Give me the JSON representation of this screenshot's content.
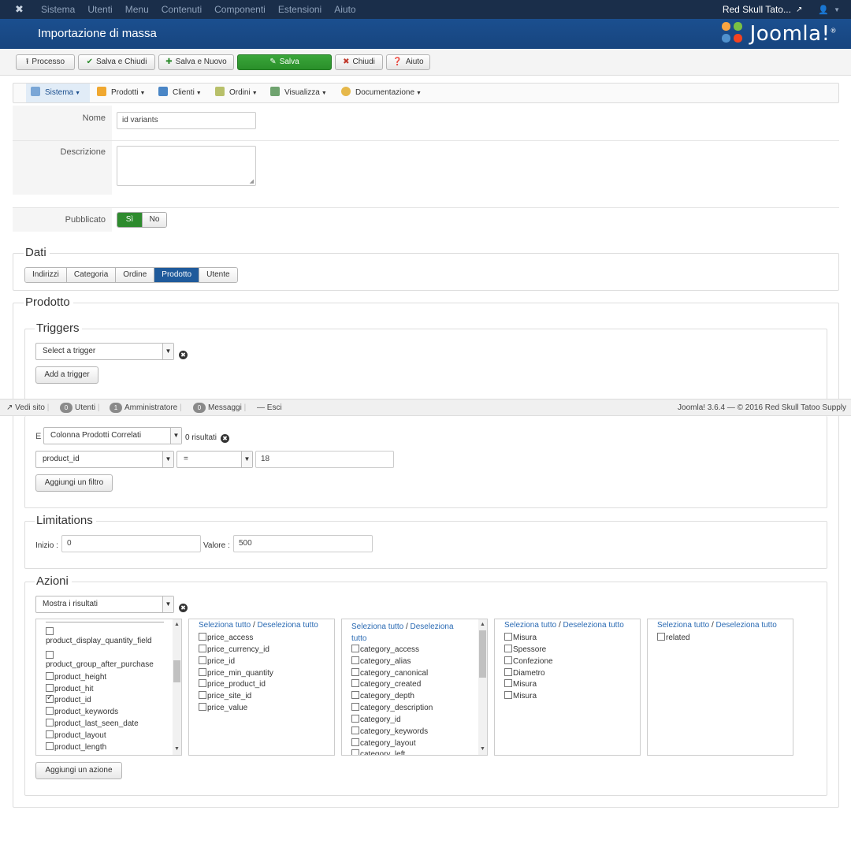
{
  "topbar": {
    "menu": [
      "Sistema",
      "Utenti",
      "Menu",
      "Contenuti",
      "Componenti",
      "Estensioni",
      "Aiuto"
    ],
    "site_name": "Red Skull Tato...",
    "ext_icon": "external-link-icon",
    "user_icon": "user-icon"
  },
  "header": {
    "title": "Importazione di massa",
    "logo_text": "Joomla!",
    "logo_mark": "®"
  },
  "toolbar": {
    "processo": "Processo",
    "salva_chiudi": "Salva e Chiudi",
    "salva_nuovo": "Salva e Nuovo",
    "salva": "Salva",
    "chiudi": "Chiudi",
    "aiuto": "Aiuto"
  },
  "subnav": {
    "items": [
      "Sistema",
      "Prodotti",
      "Clienti",
      "Ordini",
      "Visualizza",
      "Documentazione"
    ]
  },
  "form": {
    "nome_label": "Nome",
    "nome_value": "id variants",
    "descrizione_label": "Descrizione",
    "pubblicato_label": "Pubblicato",
    "si": "Sì",
    "no": "No"
  },
  "dati": {
    "legend": "Dati",
    "tabs": [
      "Indirizzi",
      "Categoria",
      "Ordine",
      "Prodotto",
      "Utente"
    ],
    "active_tab": "Prodotto"
  },
  "prodotto": {
    "legend": "Prodotto"
  },
  "triggers": {
    "legend": "Triggers",
    "select": "Select a trigger",
    "add": "Add a trigger"
  },
  "statusbar": {
    "vedi_sito": "Vedi sito",
    "utenti_count": "0",
    "utenti": "Utenti",
    "admin_count": "1",
    "admin": "Amministratore",
    "msg_count": "0",
    "messaggi": "Messaggi",
    "esci": "Esci",
    "version": "Joomla! 3.6.4 — © 2016 Red Skull Tatoo Supply"
  },
  "filters": {
    "e_label": "E",
    "column_select": "Colonna Prodotti Correlati",
    "results": "0 risultati",
    "field": "product_id",
    "operator": "=",
    "value": "18",
    "add": "Aggiungi un filtro"
  },
  "limitations": {
    "legend": "Limitations",
    "inizio_label": "Inizio :",
    "inizio_value": "0",
    "valore_label": "Valore :",
    "valore_value": "500"
  },
  "azioni": {
    "legend": "Azioni",
    "select": "Mostra i risultati",
    "add": "Aggiungi un azione",
    "select_all": "Seleziona tutto",
    "slash": "/",
    "deselect_all": "Deseleziona tutto",
    "col1": [
      "product_display_quantity_field",
      "product_group_after_purchase",
      "product_height",
      "product_hit",
      "product_id",
      "product_keywords",
      "product_last_seen_date",
      "product_layout",
      "product_length"
    ],
    "col2": [
      "price_access",
      "price_currency_id",
      "price_id",
      "price_min_quantity",
      "price_product_id",
      "price_site_id",
      "price_value"
    ],
    "col3": [
      "category_access",
      "category_alias",
      "category_canonical",
      "category_created",
      "category_depth",
      "category_description",
      "category_id",
      "category_keywords",
      "category_layout",
      "category_left"
    ],
    "col4": [
      "Misura",
      "Spessore",
      "Confezione",
      "Diametro",
      "Misura",
      "Misura"
    ],
    "col5": [
      "related"
    ]
  }
}
